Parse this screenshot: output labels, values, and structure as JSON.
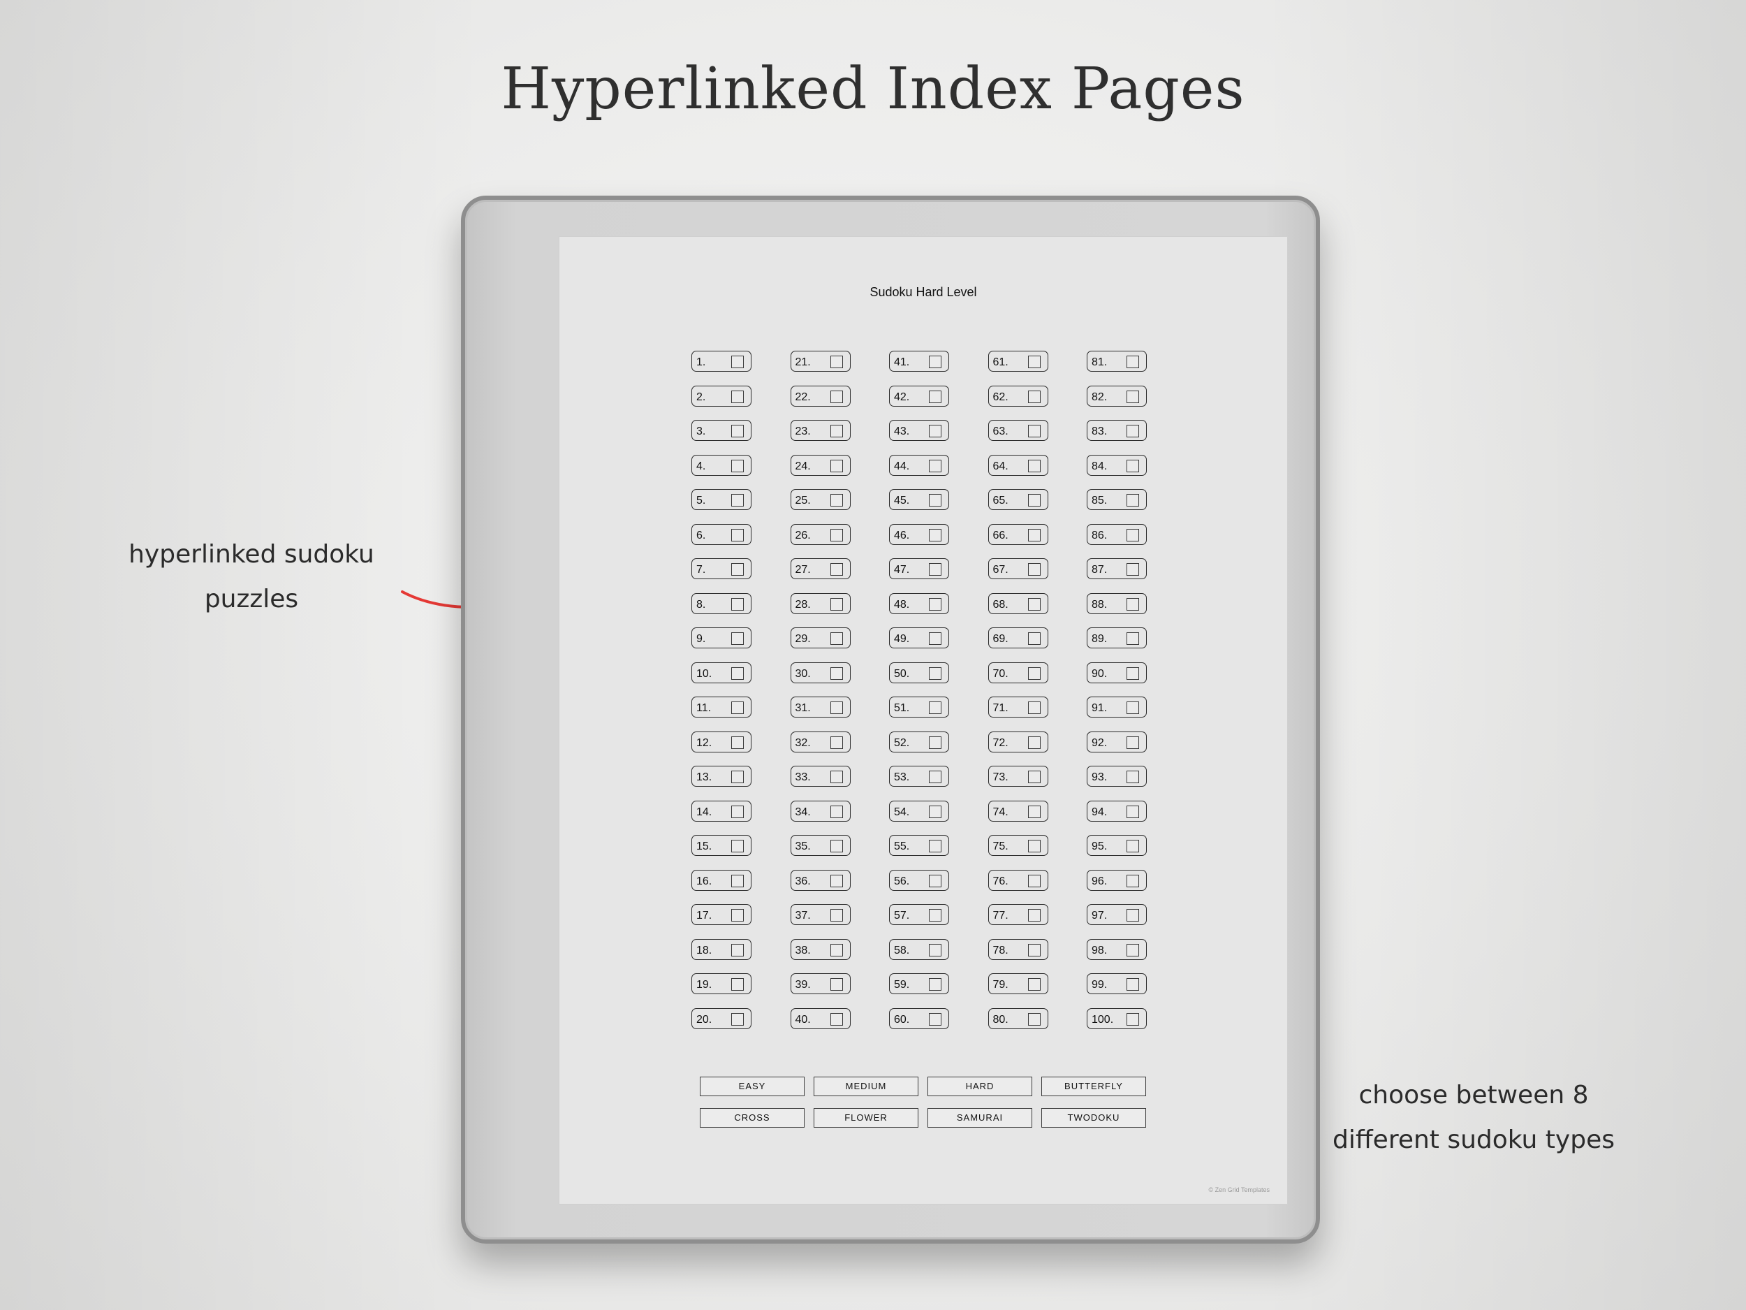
{
  "headline": "Hyperlinked Index Pages",
  "notes": {
    "left_line1": "hyperlinked sudoku",
    "left_line2": "puzzles",
    "right_line1": "choose between 8",
    "right_line2": "different sudoku types"
  },
  "screen": {
    "title": "Sudoku Hard Level",
    "puzzle_labels": [
      "1.",
      "2.",
      "3.",
      "4.",
      "5.",
      "6.",
      "7.",
      "8.",
      "9.",
      "10.",
      "11.",
      "12.",
      "13.",
      "14.",
      "15.",
      "16.",
      "17.",
      "18.",
      "19.",
      "20.",
      "21.",
      "22.",
      "23.",
      "24.",
      "25.",
      "26.",
      "27.",
      "28.",
      "29.",
      "30.",
      "31.",
      "32.",
      "33.",
      "34.",
      "35.",
      "36.",
      "37.",
      "38.",
      "39.",
      "40.",
      "41.",
      "42.",
      "43.",
      "44.",
      "45.",
      "46.",
      "47.",
      "48.",
      "49.",
      "50.",
      "51.",
      "52.",
      "53.",
      "54.",
      "55.",
      "56.",
      "57.",
      "58.",
      "59.",
      "60.",
      "61.",
      "62.",
      "63.",
      "64.",
      "65.",
      "66.",
      "67.",
      "68.",
      "69.",
      "70.",
      "71.",
      "72.",
      "73.",
      "74.",
      "75.",
      "76.",
      "77.",
      "78.",
      "79.",
      "80.",
      "81.",
      "82.",
      "83.",
      "84.",
      "85.",
      "86.",
      "87.",
      "88.",
      "89.",
      "90.",
      "91.",
      "92.",
      "93.",
      "94.",
      "95.",
      "96.",
      "97.",
      "98.",
      "99.",
      "100."
    ],
    "types": [
      "EASY",
      "MEDIUM",
      "HARD",
      "BUTTERFLY",
      "CROSS",
      "FLOWER",
      "SAMURAI",
      "TWODOKU"
    ],
    "copyright": "© Zen Grid Templates"
  },
  "colors": {
    "arrow": "#e53935",
    "text": "#2b2b2b"
  }
}
